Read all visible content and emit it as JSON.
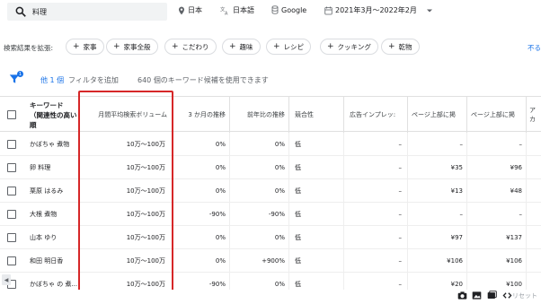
{
  "search": {
    "value": "料理"
  },
  "top_filters": {
    "location": "日本",
    "language": "日本語",
    "engine": "Google",
    "date_range": "2021年3月～2022年2月"
  },
  "expand": {
    "label": "検索結果を拡張:",
    "chips": [
      "家事",
      "家事全般",
      "こだわり",
      "趣味",
      "レシピ",
      "クッキング",
      "乾物"
    ],
    "more": "不る"
  },
  "filter_row": {
    "count": "他 1 個",
    "add": "フィルタを追加",
    "candidates": "640 個のキーワード候補を使用できます"
  },
  "columns": {
    "keyword_line1": "キーワード",
    "keyword_line2": "（関連性の高い順",
    "monthly": "月間平均検索ボリューム",
    "three_month": "3 か月の推移",
    "yoy": "前年比の推移",
    "competition": "競合性",
    "impression_share": "広告インプレッ:",
    "top_low": "ページ上部に掲",
    "top_high": "ページ上部に掲",
    "extra": "アカ"
  },
  "rows": [
    {
      "keyword": "かぼちゃ 煮物",
      "monthly": "10万～100万",
      "three_month": "0%",
      "yoy": "0%",
      "competition": "低",
      "impression": "–",
      "top_low": "–",
      "top_high": "–"
    },
    {
      "keyword": "卵 料理",
      "monthly": "10万～100万",
      "three_month": "0%",
      "yoy": "0%",
      "competition": "低",
      "impression": "–",
      "top_low": "¥35",
      "top_high": "¥96"
    },
    {
      "keyword": "栗原 はるみ",
      "monthly": "10万～100万",
      "three_month": "0%",
      "yoy": "0%",
      "competition": "低",
      "impression": "–",
      "top_low": "¥13",
      "top_high": "¥48"
    },
    {
      "keyword": "大根 煮物",
      "monthly": "10万～100万",
      "three_month": "-90%",
      "yoy": "-90%",
      "competition": "低",
      "impression": "–",
      "top_low": "–",
      "top_high": "–"
    },
    {
      "keyword": "山本 ゆり",
      "monthly": "10万～100万",
      "three_month": "0%",
      "yoy": "0%",
      "competition": "低",
      "impression": "–",
      "top_low": "¥97",
      "top_high": "¥137"
    },
    {
      "keyword": "和田 明日香",
      "monthly": "10万～100万",
      "three_month": "0%",
      "yoy": "+900%",
      "competition": "低",
      "impression": "–",
      "top_low": "¥106",
      "top_high": "¥106"
    },
    {
      "keyword": "かぼちゃ の 煮...",
      "monthly": "10万～100万",
      "three_month": "-90%",
      "yoy": "0%",
      "competition": "低",
      "impression": "–",
      "top_low": "¥20",
      "top_high": "¥100"
    }
  ],
  "bottom": {
    "reset": "リセット"
  },
  "colors": {
    "accent": "#1a73e8",
    "highlight": "#d62728"
  }
}
